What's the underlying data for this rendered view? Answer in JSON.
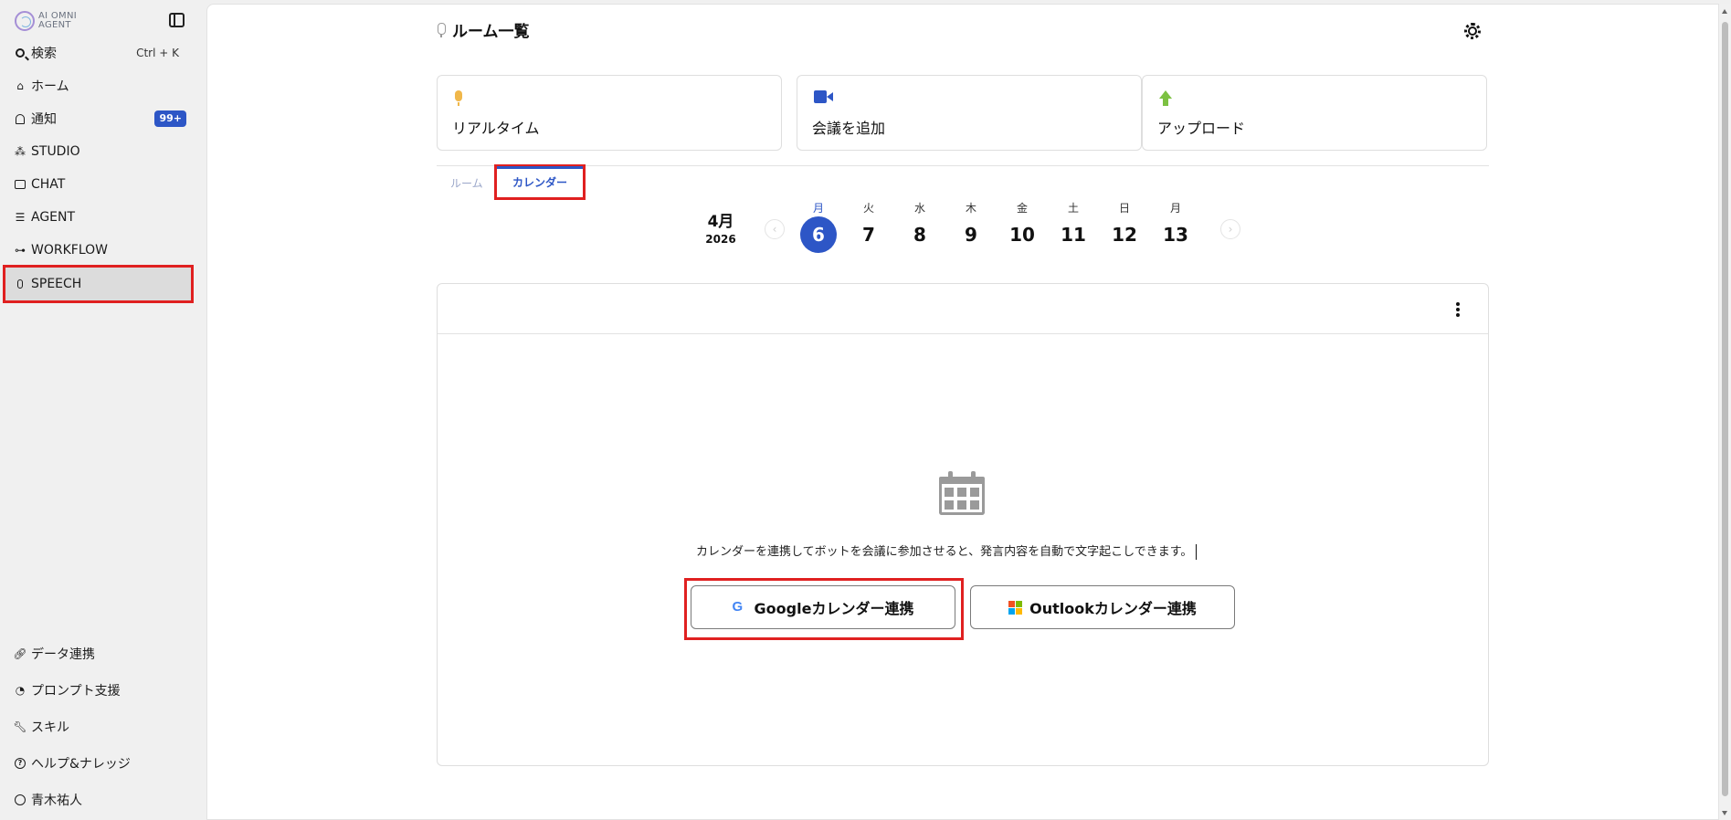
{
  "sidebar": {
    "logo": {
      "line1": "AI OMNI",
      "line2": "AGENT"
    },
    "search": {
      "label": "検索",
      "shortcut": "Ctrl + K"
    },
    "items": [
      {
        "label": "ホーム"
      },
      {
        "label": "通知",
        "badge": "99+"
      },
      {
        "label": "STUDIO"
      },
      {
        "label": "CHAT"
      },
      {
        "label": "AGENT"
      },
      {
        "label": "WORKFLOW"
      },
      {
        "label": "SPEECH"
      }
    ],
    "bottom_items": [
      {
        "label": "データ連携"
      },
      {
        "label": "プロンプト支援"
      },
      {
        "label": "スキル"
      },
      {
        "label": "ヘルプ&ナレッジ"
      },
      {
        "label": "青木祐人"
      }
    ]
  },
  "header": {
    "title": "ルーム一覧"
  },
  "actions": [
    {
      "label": "リアルタイム",
      "icon": "mic-icon"
    },
    {
      "label": "会議を追加",
      "icon": "video-camera-icon"
    },
    {
      "label": "アップロード",
      "icon": "upload-arrow-icon"
    }
  ],
  "tabs": [
    {
      "label": "ルーム"
    },
    {
      "label": "カレンダー"
    }
  ],
  "calendar": {
    "month": "4月",
    "year": "2026",
    "days": [
      {
        "dow": "月",
        "num": "6"
      },
      {
        "dow": "火",
        "num": "7"
      },
      {
        "dow": "水",
        "num": "8"
      },
      {
        "dow": "木",
        "num": "9"
      },
      {
        "dow": "金",
        "num": "10"
      },
      {
        "dow": "土",
        "num": "11"
      },
      {
        "dow": "日",
        "num": "12"
      },
      {
        "dow": "月",
        "num": "13"
      }
    ],
    "selected_index": 0,
    "prev_arrow": "‹",
    "next_arrow": "›"
  },
  "empty_state": {
    "message": "カレンダーを連携してボットを会議に参加させると、発言内容を自動で文字起こしできます。",
    "google_button": "Googleカレンダー連携",
    "google_logo": "G",
    "outlook_button": "Outlookカレンダー連携"
  },
  "colors": {
    "accent": "#2d56c6",
    "highlight": "#e02020",
    "badge": "#2d56c6"
  }
}
